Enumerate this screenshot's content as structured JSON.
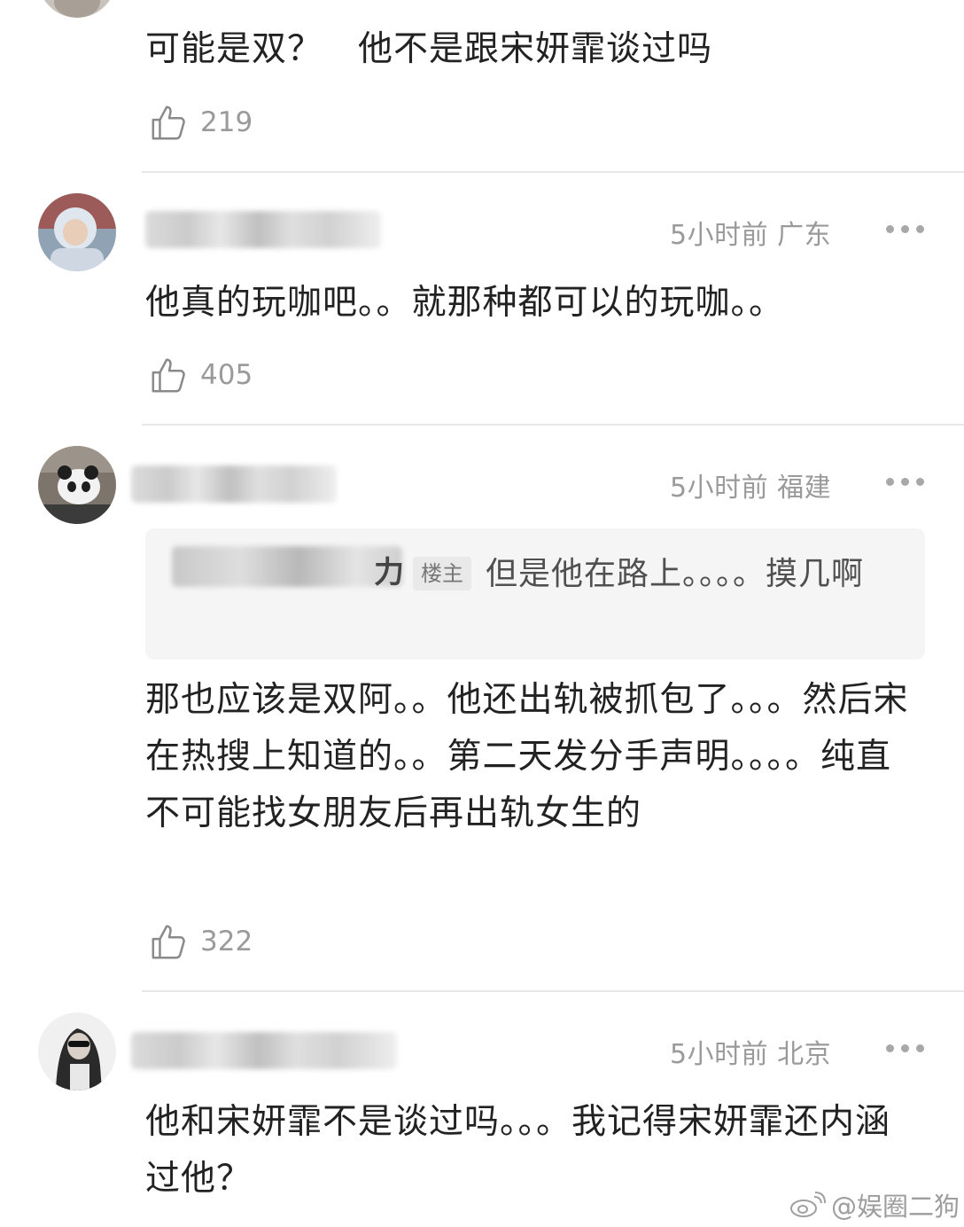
{
  "comments": [
    {
      "text": "可能是双？　他不是跟宋妍霏谈过吗",
      "likes": "219"
    },
    {
      "username_partial": "",
      "meta": "5小时前 广东",
      "text": "他真的玩咖吧。。就那种都可以的玩咖。。",
      "likes": "405"
    },
    {
      "meta": "5小时前 福建",
      "quote": {
        "author_suffix": "力",
        "badge": "楼主",
        "text": "但是他在路上。。。。摸几啊"
      },
      "text": "那也应该是双阿。。他还出轨被抓包了。。。然后宋在热搜上知道的。。第二天发分手声明。。。。纯直不可能找女朋友后再出轨女生的",
      "likes": "322"
    },
    {
      "meta": "5小时前 北京",
      "text": "他和宋妍霏不是谈过吗。。。我记得宋妍霏还内涵过他？"
    }
  ],
  "watermark": "@娱圈二狗",
  "icons": {
    "like": "thumbs-up-icon",
    "more": "more-dots-icon",
    "weibo": "weibo-logo-icon"
  }
}
